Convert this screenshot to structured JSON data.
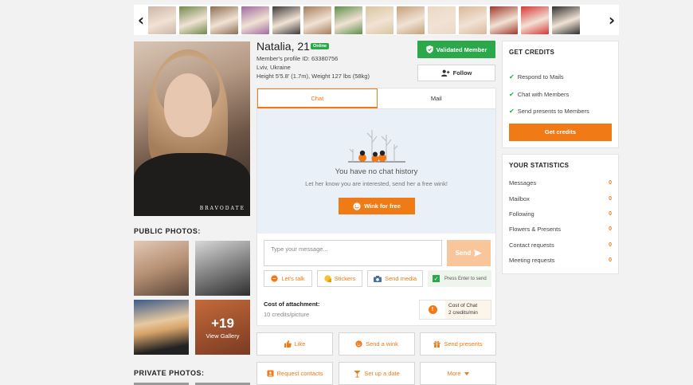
{
  "thumbstrip": {
    "prev_icon": "chevron-left-icon",
    "next_icon": "chevron-right-icon",
    "thumbs": [
      "#c9b6a9",
      "#6f8a4a",
      "#8c6f55",
      "#a06aa0",
      "#3d3a3a",
      "#a57e5c",
      "#5f8f4a",
      "#d8c7a0",
      "#c3a27a",
      "#e8d9c6",
      "#d9b89a",
      "#a0382c",
      "#d73636",
      "#2e2e2e"
    ]
  },
  "profile": {
    "name": "Natalia, 21",
    "online": "Online",
    "profile_id": "Member's profile ID: 63380756",
    "location": "Lviv, Ukraine",
    "body": "Height 5'5.8' (1.7m), Weight 127 lbs (58kg)",
    "watermark": "BRAVODATE",
    "validated": "Validated Member",
    "follow": "Follow"
  },
  "photos": {
    "public_label": "PUBLIC PHOTOS:",
    "private_label": "PRIVATE PHOTOS:",
    "more_count": "+19",
    "view_gallery": "View Gallery"
  },
  "chat": {
    "tab_chat": "Chat",
    "tab_mail": "Mail",
    "empty_title": "You have no chat history",
    "empty_sub": "Let her know you are interested, send her a free wink!",
    "wink_free": "Wink for free",
    "placeholder": "Type your message...",
    "send": "Send",
    "lets_talk": "Let's talk",
    "stickers": "Stickers",
    "send_media": "Send media",
    "press_enter": "Press Enter to send",
    "cost_attach_title": "Cost of attachment:",
    "cost_attach_value": "10 credits/picture",
    "cost_chat_title": "Cost of Chat",
    "cost_chat_value": "2 credits/min"
  },
  "actions": {
    "like": "Like",
    "send_wink": "Send a wink",
    "send_presents": "Send presents",
    "request_contacts": "Request contacts",
    "set_up_date": "Set up a date",
    "more": "More"
  },
  "credits": {
    "title": "GET CREDITS",
    "items": [
      "Respond to Mails",
      "Chat with Members",
      "Send presents to Members"
    ],
    "button": "Get credits"
  },
  "stats": {
    "title": "YOUR STATISTICS",
    "rows": [
      {
        "label": "Messages",
        "value": "0"
      },
      {
        "label": "Mailbox",
        "value": "0"
      },
      {
        "label": "Following",
        "value": "0"
      },
      {
        "label": "Flowers & Presents",
        "value": "0"
      },
      {
        "label": "Contact requests",
        "value": "0"
      },
      {
        "label": "Meeting requests",
        "value": "0"
      }
    ]
  },
  "colors": {
    "accent": "#f07a16",
    "green": "#2aa84a"
  }
}
